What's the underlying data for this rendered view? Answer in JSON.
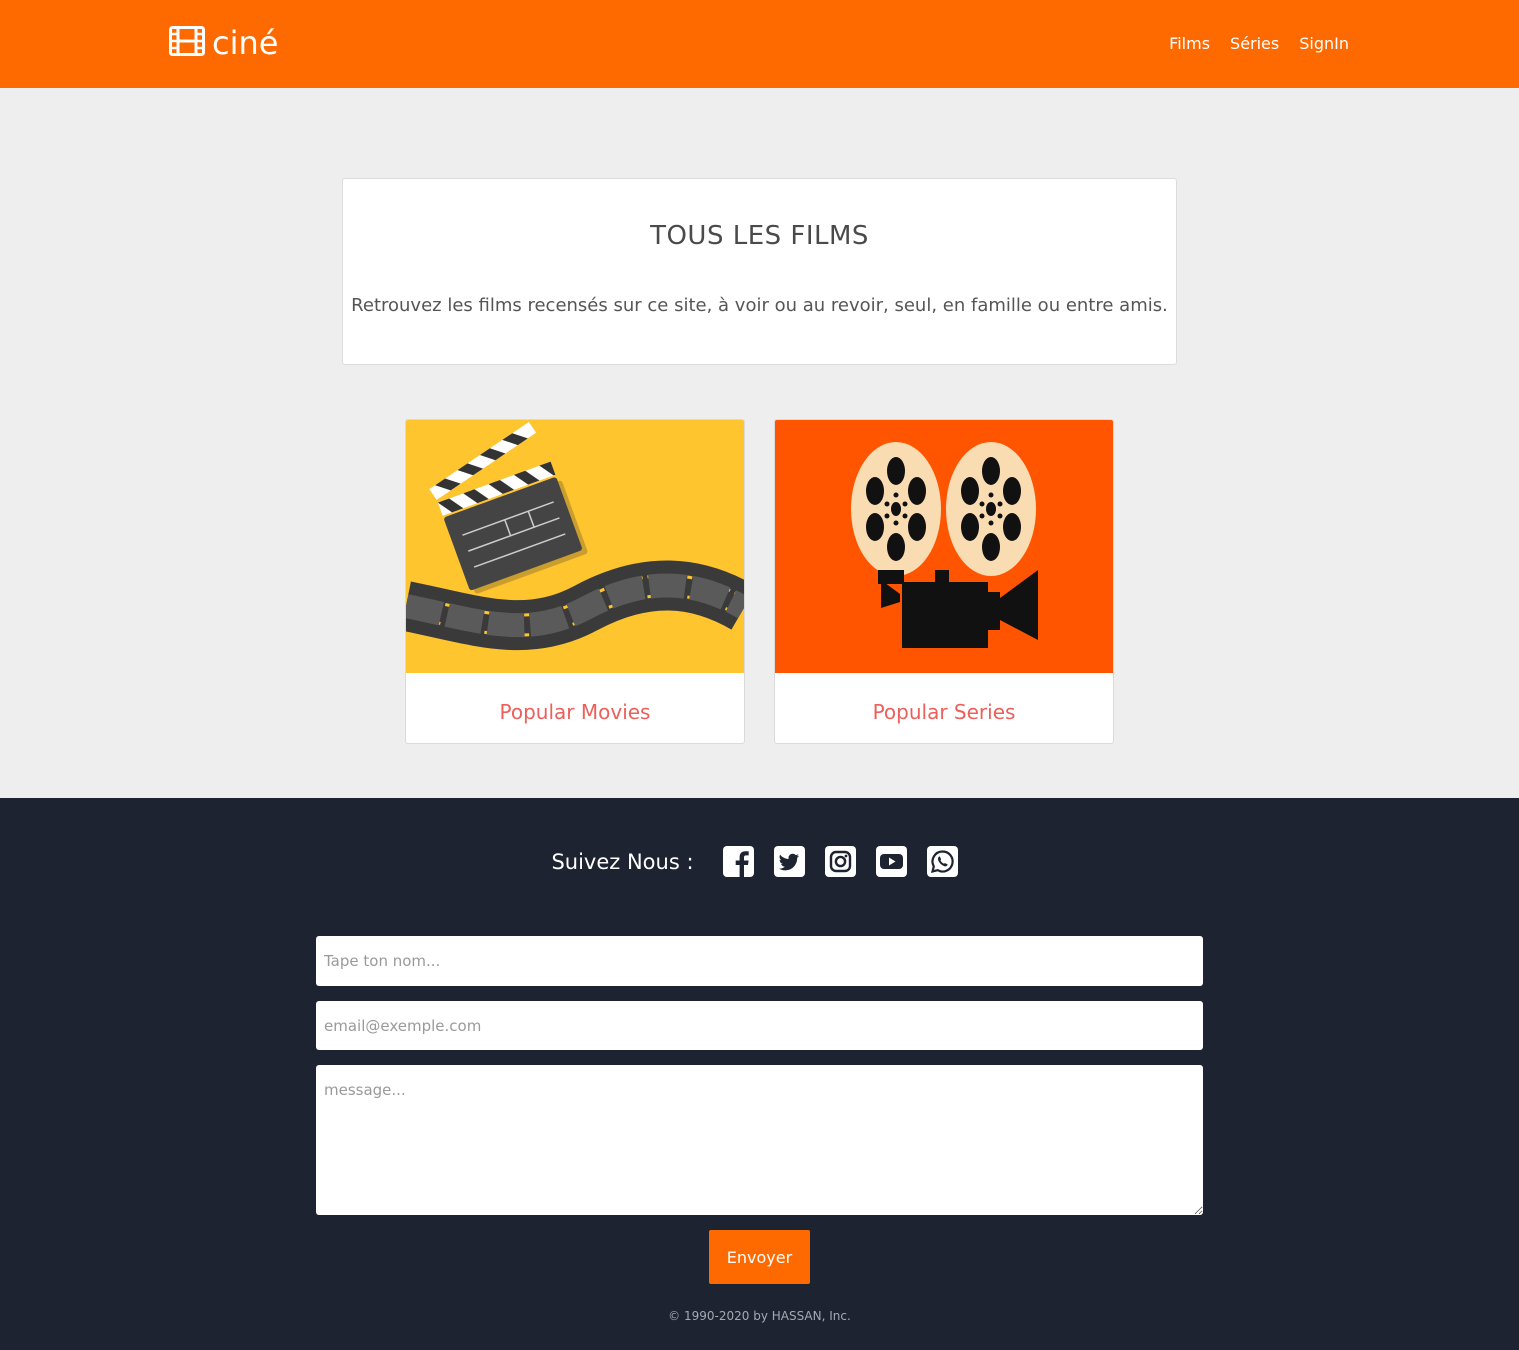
{
  "header": {
    "brand": "ciné",
    "nav": [
      "Films",
      "Séries",
      "SignIn"
    ]
  },
  "intro": {
    "title": "TOUS LES FILMS",
    "text": "Retrouvez les films recensés sur ce site, à voir ou au revoir, seul, en famille ou entre amis."
  },
  "tiles": [
    {
      "label": "Popular Movies",
      "image": "clapperboard-film-strip-illustration",
      "background": "#ffc52f"
    },
    {
      "label": "Popular Series",
      "image": "film-projector-illustration",
      "background": "#ff5500"
    }
  ],
  "footer": {
    "follow_label": "Suivez Nous :",
    "social": [
      "facebook-icon",
      "twitter-icon",
      "instagram-icon",
      "youtube-icon",
      "whatsapp-icon"
    ],
    "form": {
      "name_placeholder": "Tape ton nom...",
      "email_placeholder": "email@exemple.com",
      "message_placeholder": "message...",
      "submit_label": "Envoyer"
    },
    "copyright": "© 1990-2020 by HASSAN, Inc."
  },
  "colors": {
    "accent": "#ff6a00",
    "page_bg": "#eeeeee",
    "footer_bg": "#1d2331",
    "tile_label": "#ec5f5a"
  }
}
